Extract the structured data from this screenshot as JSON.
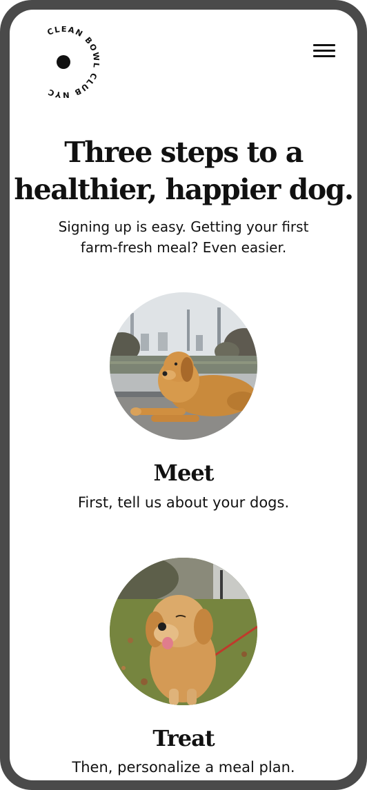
{
  "header": {
    "logo_text": "CLEAN BOWL CLUB NYC",
    "menu_icon": "hamburger-menu-icon"
  },
  "hero": {
    "title_line1": "Three steps to a",
    "title_line2": "healthier, happier dog.",
    "subtitle_line1": "Signing up is easy. Getting your first",
    "subtitle_line2": "farm-fresh meal? Even easier."
  },
  "steps": [
    {
      "title": "Meet",
      "description": "First, tell us about your dogs."
    },
    {
      "title": "Treat",
      "description": "Then, personalize a meal plan."
    }
  ],
  "colors": {
    "text": "#111111",
    "frame": "#4a4a4a",
    "background": "#ffffff",
    "dog_coat": "#c98a3c"
  }
}
